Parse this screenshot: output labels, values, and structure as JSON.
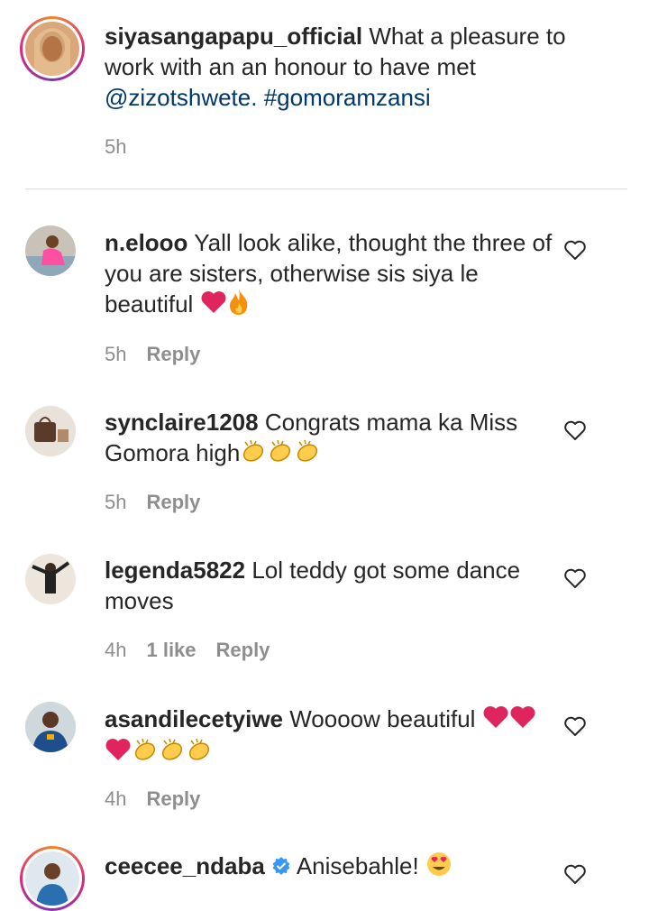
{
  "caption": {
    "username": "siyasangapapu_official",
    "text": "What a pleasure to work with an an honour to have met",
    "mention": "@zizotshwete.",
    "hashtag": "#gomoramzansi",
    "time": "5h"
  },
  "comments": [
    {
      "username": "n.elooo",
      "text": "Yall look alike, thought the three of you are sisters, otherwise sis siya le beautiful",
      "emojis": [
        "red-heart",
        "fire"
      ],
      "time": "5h",
      "reply_label": "Reply"
    },
    {
      "username": "synclaire1208",
      "text": "Congrats mama ka Miss Gomora high",
      "emojis": [
        "clap",
        "clap",
        "clap"
      ],
      "time": "5h",
      "reply_label": "Reply"
    },
    {
      "username": "legenda5822",
      "text": "Lol teddy got some dance moves",
      "emojis": [],
      "time": "4h",
      "likes": "1 like",
      "reply_label": "Reply"
    },
    {
      "username": "asandilecetyiwe",
      "text": "Woooow beautiful",
      "emojis": [
        "red-heart",
        "red-heart",
        "red-heart",
        "clap",
        "clap",
        "clap"
      ],
      "time": "4h",
      "reply_label": "Reply"
    },
    {
      "username": "ceecee_ndaba",
      "verified": true,
      "text": "Anisebahle!",
      "emojis": [
        "heart-eyes"
      ]
    }
  ],
  "colors": {
    "text": "#262626",
    "secondary": "#8e8e8e",
    "link": "#00376b",
    "divider": "#dbdbdb",
    "heart_emoji": "#e0245e",
    "verified": "#3897f0"
  }
}
